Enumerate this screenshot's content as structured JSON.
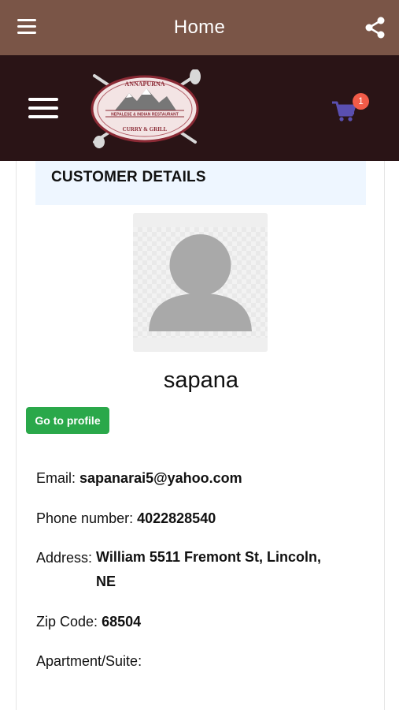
{
  "appbar": {
    "title": "Home",
    "menu_icon": "hamburger-icon",
    "share_icon": "share-icon"
  },
  "brandbar": {
    "menu_icon": "hamburger-icon",
    "logo": {
      "top_text": "ANNAPURNA",
      "middle_text": "NEPALESE & INDIAN RESTAURANT",
      "bottom_text": "CURRY & GRILL"
    },
    "cart": {
      "icon": "cart-icon",
      "count": "1"
    }
  },
  "customer": {
    "section_title": "CUSTOMER DETAILS",
    "name": "sapana",
    "profile_button": "Go to profile",
    "fields": {
      "email": {
        "label": "Email:",
        "value": "sapanarai5@yahoo.com"
      },
      "phone": {
        "label": "Phone number:",
        "value": "4022828540"
      },
      "address": {
        "label": "Address:",
        "value_line1": "William 5511 Fremont St, Lincoln,",
        "value_line2": "NE"
      },
      "zip": {
        "label": "Zip Code:",
        "value": "68504"
      },
      "apartment": {
        "label": "Apartment/Suite:",
        "value": ""
      }
    }
  },
  "colors": {
    "appbar": "#7a5547",
    "brandbar": "#2a1416",
    "badge": "#f15b48",
    "profile_button": "#2aa84a",
    "section_header": "#eef6ff"
  }
}
